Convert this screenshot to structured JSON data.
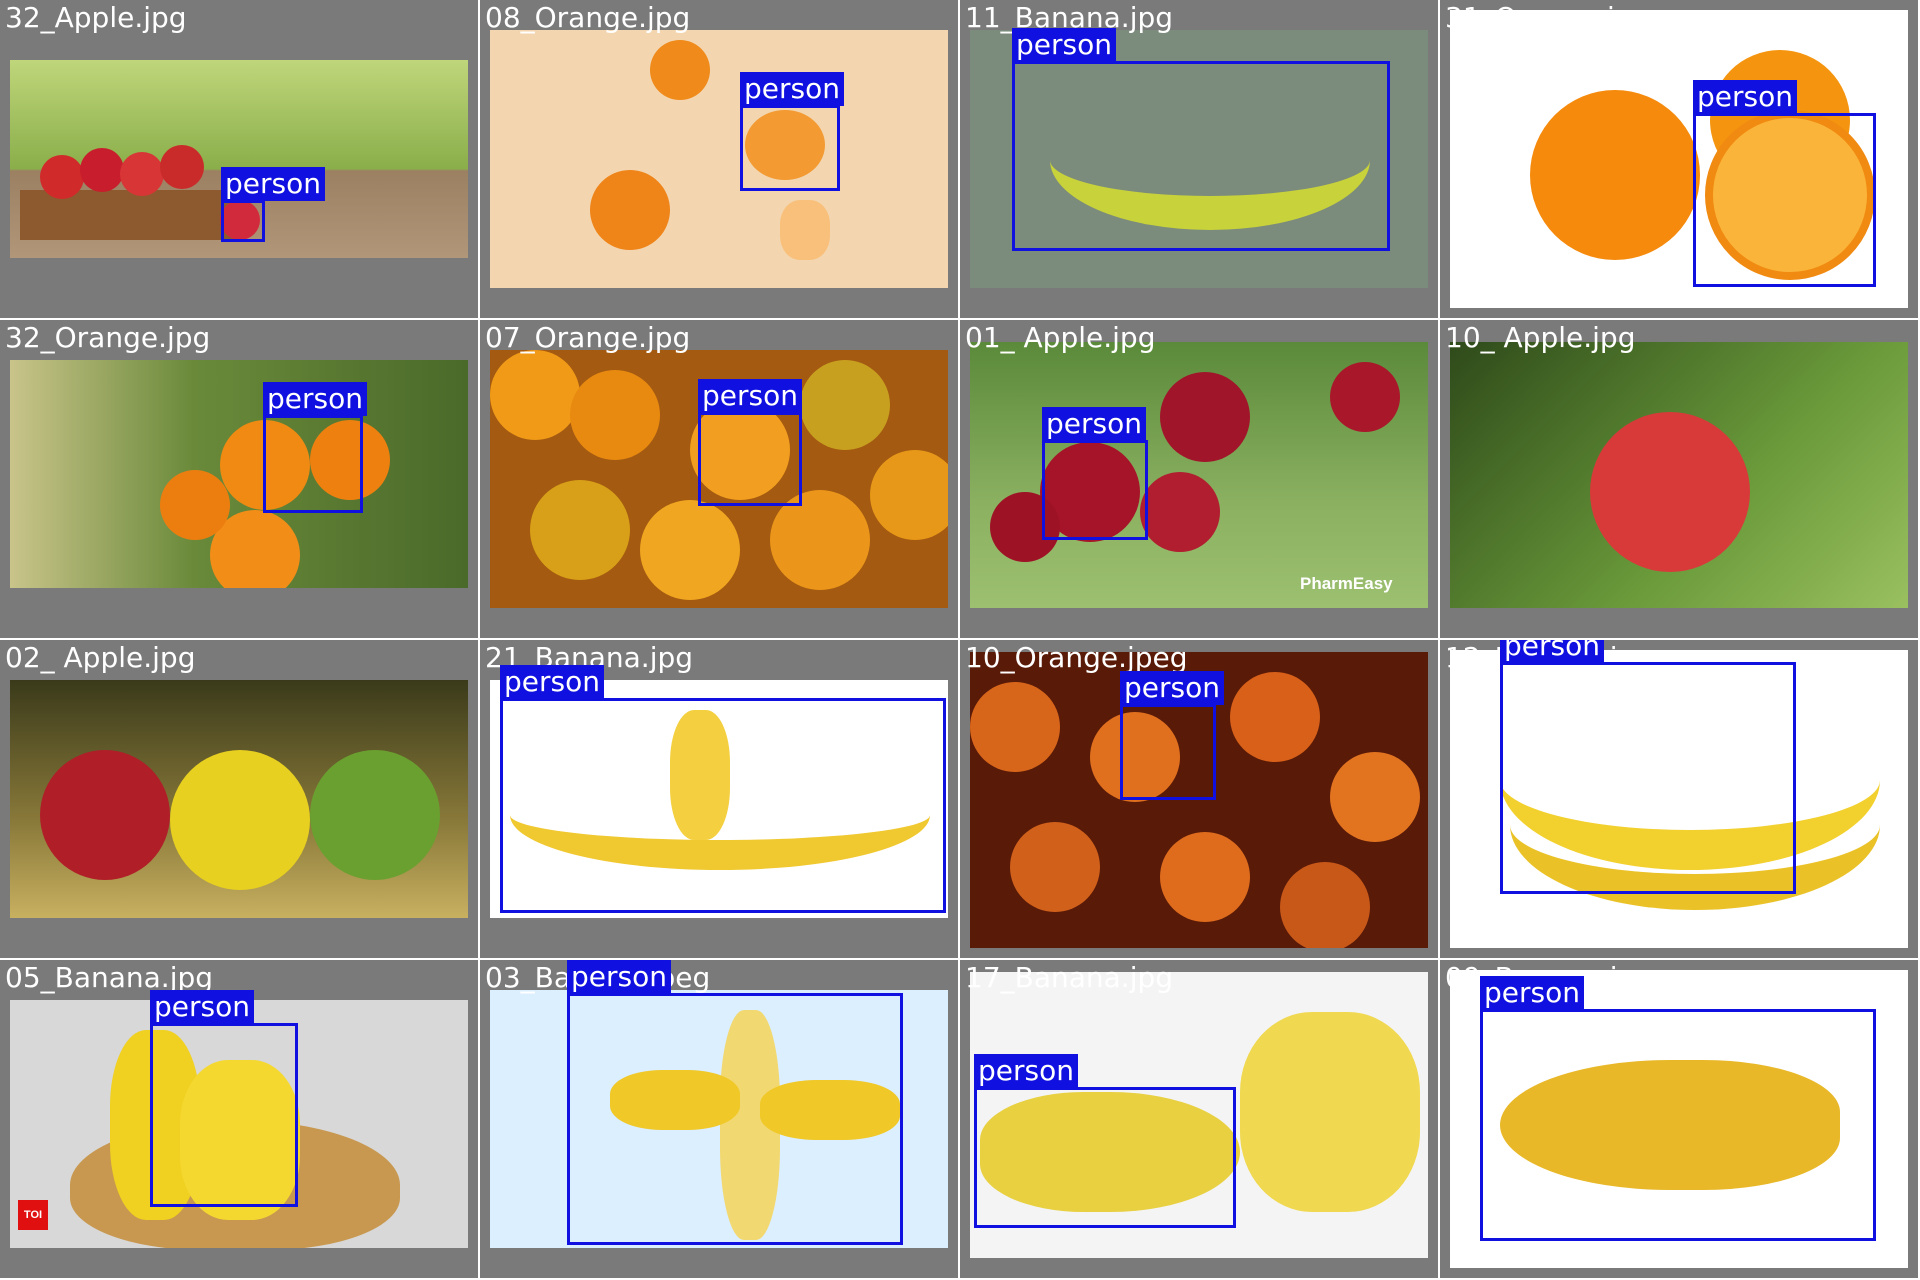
{
  "detection_label": "person",
  "colors": {
    "tile_bg": "#7a7a7a",
    "box": "#1010e0",
    "label_text": "#ffffff"
  },
  "tiles": [
    {
      "file": "32_Apple.jpg",
      "label": "person",
      "fruit": "apple"
    },
    {
      "file": "08_Orange.jpg",
      "label": "person",
      "fruit": "orange"
    },
    {
      "file": "11_Banana.jpg",
      "label": "person",
      "fruit": "banana"
    },
    {
      "file": "31_Orange.jpg",
      "label": "person",
      "fruit": "orange"
    },
    {
      "file": "32_Orange.jpg",
      "label": "person",
      "fruit": "orange"
    },
    {
      "file": "07_Orange.jpg",
      "label": "person",
      "fruit": "orange"
    },
    {
      "file": "01_ Apple.jpg",
      "label": "person",
      "fruit": "apple",
      "watermark": "PharmEasy"
    },
    {
      "file": "10_ Apple.jpg",
      "fruit": "apple"
    },
    {
      "file": "02_ Apple.jpg",
      "fruit": "apple"
    },
    {
      "file": "21_Banana.jpg",
      "label": "person",
      "fruit": "banana"
    },
    {
      "file": "10_Orange.jpeg",
      "label": "person",
      "fruit": "orange"
    },
    {
      "file": "12_Banana.jpg",
      "label": "person",
      "fruit": "banana"
    },
    {
      "file": "05_Banana.jpg",
      "label": "person",
      "fruit": "banana",
      "watermark": "TOI"
    },
    {
      "file": "03_Banana.jpeg",
      "label": "person",
      "fruit": "banana"
    },
    {
      "file": "17_Banana.jpg",
      "label": "person",
      "fruit": "banana"
    },
    {
      "file": "09_Banana.jpg",
      "label": "person",
      "fruit": "banana"
    }
  ]
}
